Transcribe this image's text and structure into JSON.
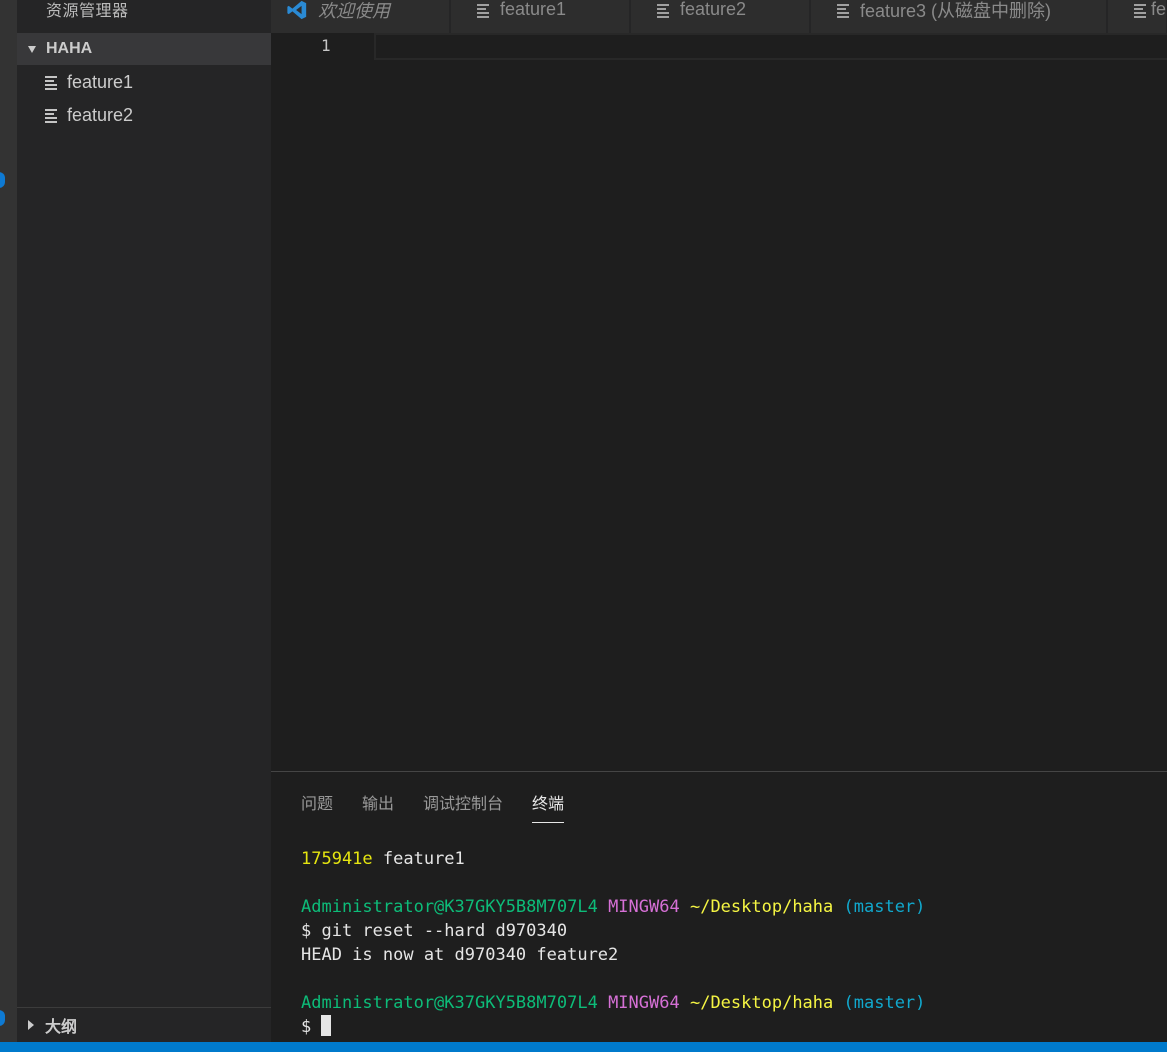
{
  "sidebar": {
    "title": "资源管理器",
    "section_title": "HAHA",
    "files": [
      {
        "label": "feature1"
      },
      {
        "label": "feature2"
      }
    ],
    "outline_title": "大纲"
  },
  "tabs": [
    {
      "label": "欢迎使用"
    },
    {
      "label": "feature1"
    },
    {
      "label": "feature2"
    },
    {
      "label": "feature3 (从磁盘中删除)"
    },
    {
      "label": "fe"
    }
  ],
  "editor": {
    "line_number": "1"
  },
  "panel": {
    "tabs": [
      {
        "label": "问题"
      },
      {
        "label": "输出"
      },
      {
        "label": "调试控制台"
      },
      {
        "label": "终端"
      }
    ]
  },
  "terminal": {
    "line1_hash": "175941e",
    "line1_msg": " feature1",
    "prompt_user": "Administrator@K37GKY5B8M707L4",
    "prompt_env": "MINGW64",
    "prompt_path": "~/Desktop/haha",
    "prompt_branch": "(master)",
    "command": "$ git reset --hard d970340",
    "output": "HEAD is now at d970340 feature2",
    "prompt_symbol": "$ "
  },
  "colors": {
    "accent": "#007acc",
    "terminal_green": "#0dbc79",
    "terminal_magenta": "#d670d6",
    "terminal_yellow": "#e5e510",
    "terminal_cyan": "#11a8cd"
  }
}
